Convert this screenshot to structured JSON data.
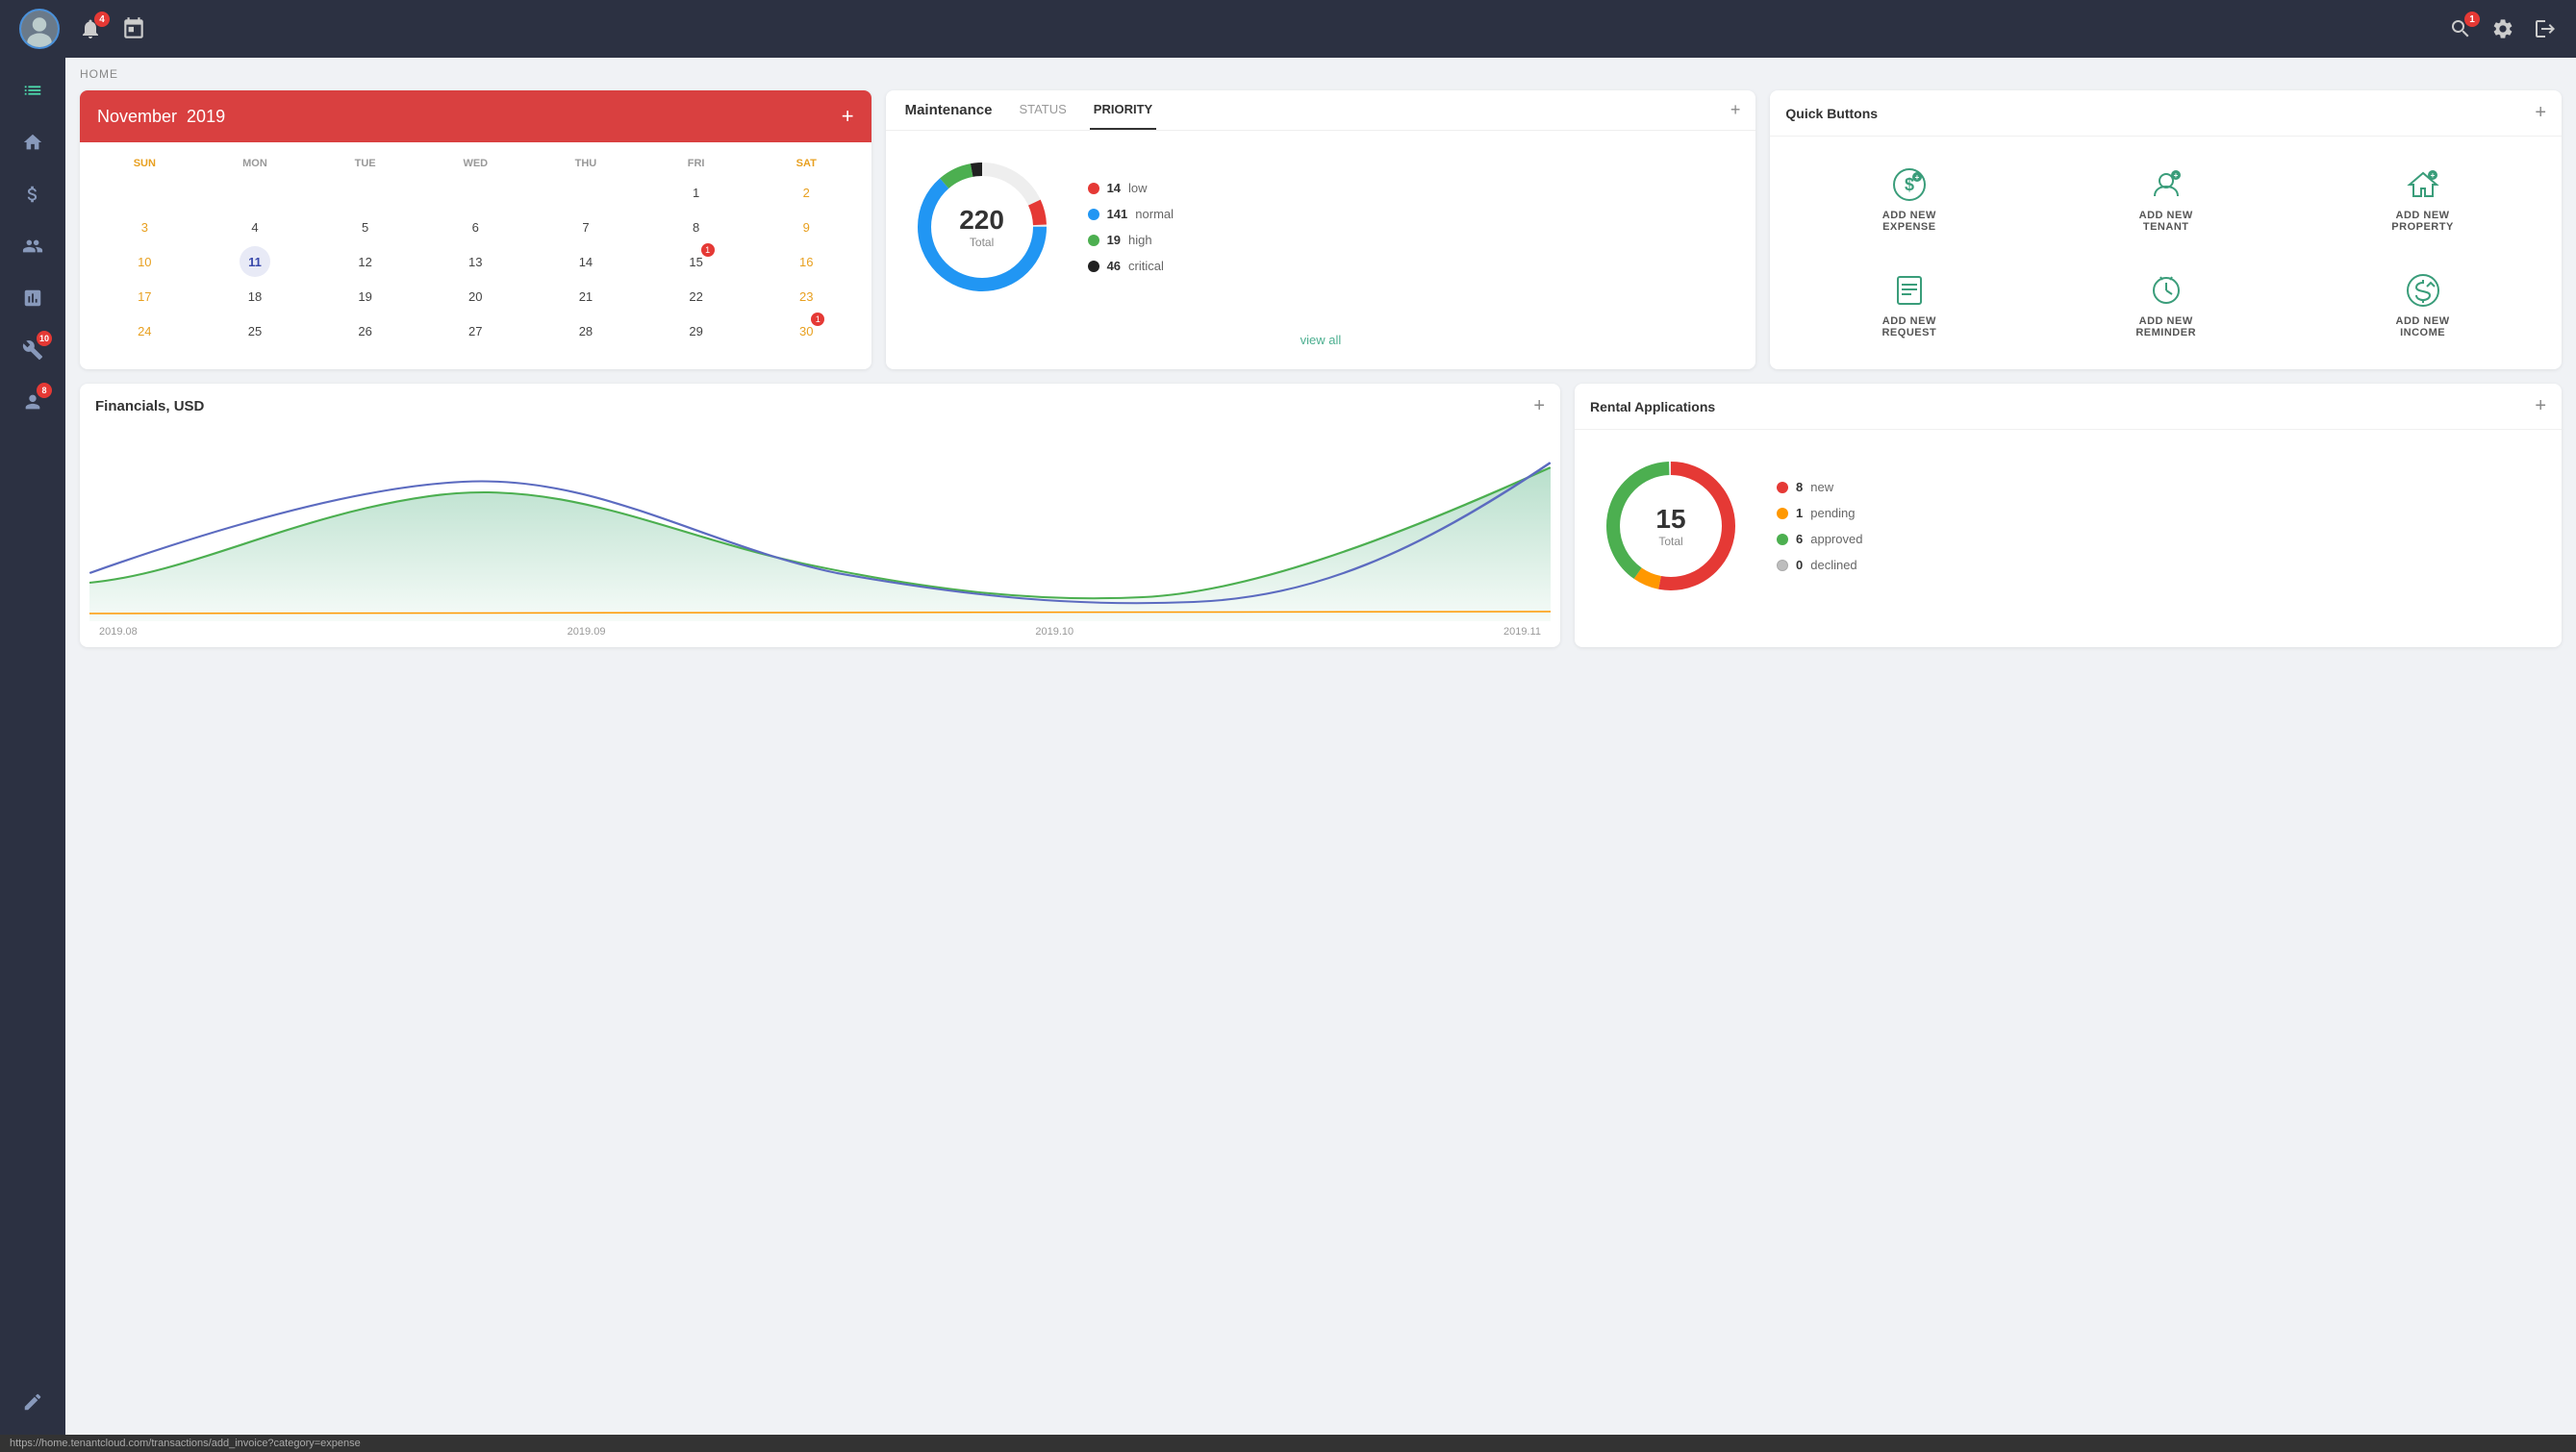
{
  "topbar": {
    "notifications_count": "4",
    "messages_count": "1"
  },
  "breadcrumb": "HOME",
  "calendar": {
    "month": "November",
    "year": "2019",
    "days_header": [
      "SUN",
      "MON",
      "TUE",
      "WED",
      "THU",
      "FRI",
      "SAT"
    ],
    "weeks": [
      [
        null,
        null,
        null,
        null,
        null,
        "1",
        "2"
      ],
      [
        "3",
        "4",
        "5",
        "6",
        "7",
        "8",
        "9"
      ],
      [
        "10",
        "11",
        "12",
        "13",
        "14",
        "15",
        "16"
      ],
      [
        "17",
        "18",
        "19",
        "20",
        "21",
        "22",
        "23"
      ],
      [
        "24",
        "25",
        "26",
        "27",
        "28",
        "29",
        "30"
      ]
    ],
    "weekend_days": [
      1,
      7
    ],
    "today": "11",
    "badges": {
      "15": "1",
      "30": "1"
    }
  },
  "maintenance": {
    "title": "Maintenance",
    "tab_status": "STATUS",
    "tab_priority": "PRIORITY",
    "total": "220",
    "total_label": "Total",
    "legend": [
      {
        "color": "#e53935",
        "count": "14",
        "label": "low"
      },
      {
        "color": "#2196f3",
        "count": "141",
        "label": "normal"
      },
      {
        "color": "#4caf50",
        "count": "19",
        "label": "high"
      },
      {
        "color": "#212121",
        "count": "46",
        "label": "critical"
      }
    ],
    "view_all": "view all"
  },
  "quick_buttons": {
    "title": "Quick Buttons",
    "items": [
      {
        "icon": "$",
        "label": "ADD NEW\nEXPENSE",
        "name": "add-new-expense"
      },
      {
        "icon": "👤",
        "label": "ADD NEW\nTENANT",
        "name": "add-new-tenant"
      },
      {
        "icon": "🏠",
        "label": "ADD NEW\nPROPERTY",
        "name": "add-new-property"
      },
      {
        "icon": "📋",
        "label": "ADD NEW\nREQUEST",
        "name": "add-new-request"
      },
      {
        "icon": "⏰",
        "label": "ADD NEW\nREMINDER",
        "name": "add-new-reminder"
      },
      {
        "icon": "$",
        "label": "ADD NEW\nINCOME",
        "name": "add-new-income"
      }
    ]
  },
  "financials": {
    "title": "Financials, USD"
  },
  "rental_applications": {
    "title": "Rental Applications",
    "total": "15",
    "total_label": "Total",
    "legend": [
      {
        "color": "#e53935",
        "count": "8",
        "label": "new"
      },
      {
        "color": "#ff9800",
        "count": "1",
        "label": "pending"
      },
      {
        "color": "#4caf50",
        "count": "6",
        "label": "approved"
      },
      {
        "color": "#bdbdbd",
        "count": "0",
        "label": "declined"
      }
    ]
  },
  "sidebar": {
    "items": [
      {
        "icon": "⊞",
        "name": "dashboard",
        "badge": null
      },
      {
        "icon": "🏠",
        "name": "properties",
        "badge": null
      },
      {
        "icon": "💲",
        "name": "financials",
        "badge": null
      },
      {
        "icon": "👥",
        "name": "tenants",
        "badge": null
      },
      {
        "icon": "📊",
        "name": "reports",
        "badge": null
      },
      {
        "icon": "🔧",
        "name": "maintenance",
        "badge": "10"
      },
      {
        "icon": "👤",
        "name": "users",
        "badge": "8"
      },
      {
        "icon": "✏️",
        "name": "edit",
        "badge": null
      }
    ]
  },
  "statusbar": {
    "url": "https://home.tenantcloud.com/transactions/add_invoice?category=expense"
  }
}
